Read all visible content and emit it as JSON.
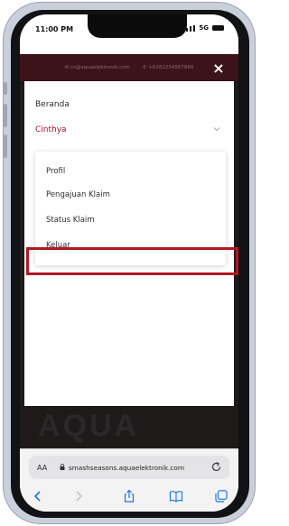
{
  "status_bar": {
    "time": "11:00 PM",
    "network": "5G"
  },
  "site": {
    "contact_email": "✉ cs@aquaelektronik.com",
    "contact_phone": "✆ +6281234567890",
    "background_logo": "AQUA"
  },
  "menu": {
    "close_label": "×",
    "home_label": "Beranda",
    "user_label": "Cinthya",
    "user_submenu": [
      {
        "label": "Profil"
      },
      {
        "label": "Pengajuan Klaim"
      },
      {
        "label": "Status Klaim"
      },
      {
        "label": "Keluar"
      }
    ],
    "highlighted_item": "Status Klaim"
  },
  "browser": {
    "aa_label": "AA",
    "url": "smashseasons.aquaelektronik.com",
    "toolbar_icons": [
      "back-icon",
      "forward-icon",
      "share-icon",
      "bookmarks-icon",
      "tabs-icon"
    ]
  },
  "colors": {
    "accent": "#a01224",
    "highlight_border": "#b01822",
    "contact_strip": "#3a1418",
    "site_background": "#1e1a1a",
    "icon_blue": "#1a73e8"
  }
}
